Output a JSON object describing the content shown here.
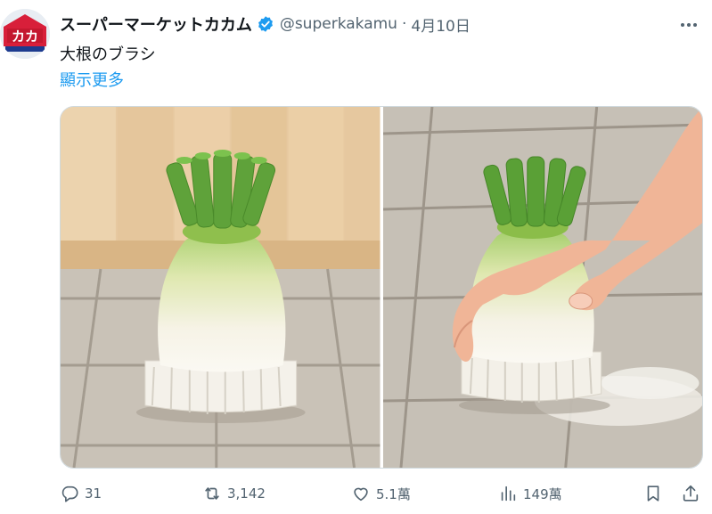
{
  "account": {
    "avatar_text": "カカ",
    "name": "スーパーマーケットカカム",
    "handle": "@superkakamu",
    "separator": "·",
    "date": "4月10日"
  },
  "post": {
    "text": "大根のブラシ",
    "show_more": "顯示更多"
  },
  "media": [
    {
      "icon": "radish-brush-on-tiles-image"
    },
    {
      "icon": "hand-scrubbing-floor-image"
    }
  ],
  "actions": {
    "replies": "31",
    "retweets": "3,142",
    "likes": "5.1萬",
    "views": "149萬"
  },
  "colors": {
    "accent": "#1d9bf0",
    "secondary_text": "#536471",
    "primary_text": "#0f1419"
  }
}
